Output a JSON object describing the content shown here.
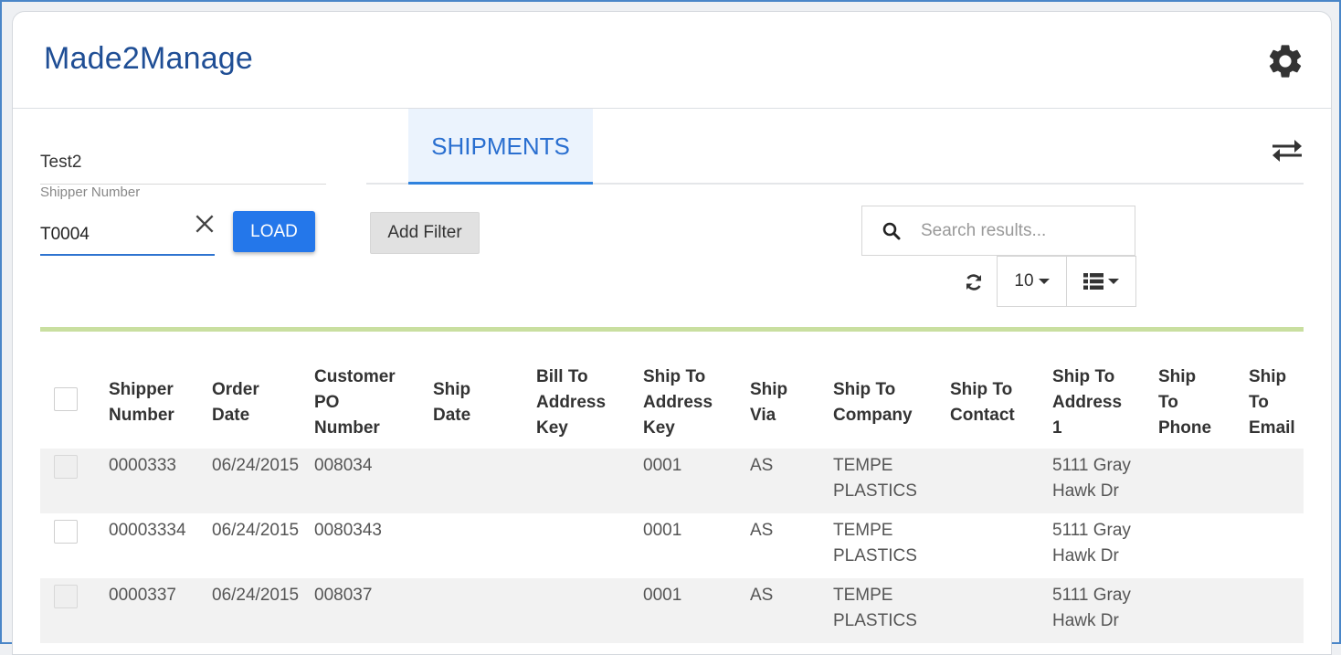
{
  "app": {
    "title": "Made2Manage",
    "settings_icon": "gear-icon"
  },
  "left_panel": {
    "profile_name": "Test2",
    "shipper_label": "Shipper Number",
    "shipper_value": "T0004",
    "clear_icon": "close-icon",
    "load_label": "LOAD"
  },
  "tabs": {
    "active": "SHIPMENTS",
    "swap_icon": "swap-arrows-icon"
  },
  "toolbar": {
    "add_filter_label": "Add Filter",
    "search_placeholder": "Search results...",
    "page_size": "10",
    "refresh_icon": "refresh-icon",
    "columns_icon": "list-columns-icon"
  },
  "colors": {
    "brand": "#1f4e95",
    "accent": "#2477ea",
    "active_tab_bg": "#ebf3fd",
    "divider": "#c9dfa0"
  },
  "table": {
    "columns": [
      "Shipper\nNumber",
      "Order\nDate",
      "Customer\nPO\nNumber",
      "Ship\nDate",
      "Bill To\nAddress\nKey",
      "Ship To\nAddress\nKey",
      "Ship\nVia",
      "Ship To\nCompany",
      "Ship To\nContact",
      "Ship To\nAddress\n1",
      "Ship\nTo\nPhone",
      "Ship\nTo\nEmail"
    ],
    "rows": [
      [
        "0000333",
        "06/24/2015",
        "008034",
        "",
        "",
        "0001",
        "AS",
        "TEMPE PLASTICS",
        "",
        "5111 Gray Hawk Dr",
        "",
        ""
      ],
      [
        "00003334",
        "06/24/2015",
        "0080343",
        "",
        "",
        "0001",
        "AS",
        "TEMPE PLASTICS",
        "",
        "5111 Gray Hawk Dr",
        "",
        ""
      ],
      [
        "0000337",
        "06/24/2015",
        "008037",
        "",
        "",
        "0001",
        "AS",
        "TEMPE PLASTICS",
        "",
        "5111 Gray Hawk Dr",
        "",
        ""
      ]
    ]
  }
}
